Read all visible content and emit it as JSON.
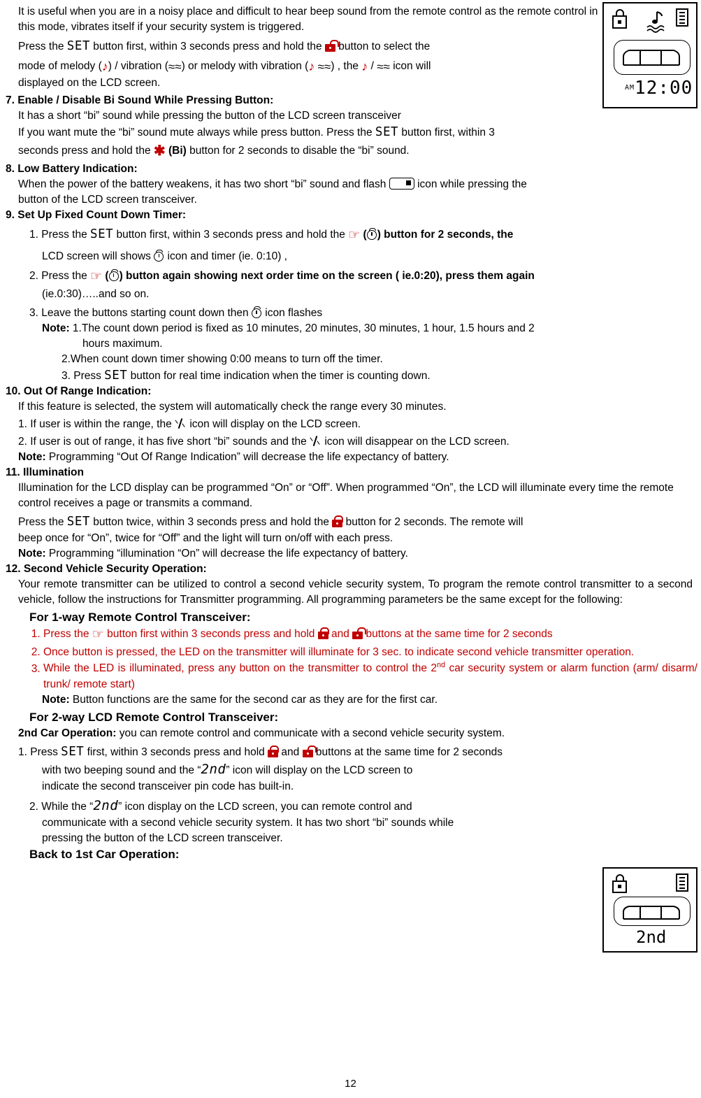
{
  "page_number": "12",
  "intro": {
    "line1": "It is useful when you are in a noisy place and difficult to hear beep sound from the remote control as the remote control in this mode, vibrates itself if your security system is triggered.",
    "line2_a": "Press the",
    "line2_set": "SET",
    "line2_b": "button first, within 3 seconds press and hold the",
    "line2_c": "button to select the",
    "line3_a": "mode of melody (",
    "line3_b": ") / vibration (",
    "line3_c": ") or melody with vibration (",
    "line3_d": ") , the",
    "line3_e": "/",
    "line3_f": "icon will",
    "line4": "displayed on the LCD screen."
  },
  "sections": [
    {
      "heading": "7. Enable / Disable Bi Sound While Pressing Button:",
      "lines": [
        "It has a short “bi” sound while pressing the button of the LCD screen transceiver",
        "If you want mute the “bi” sound mute always while press button. Press the",
        "button first, within 3",
        "seconds press and hold the",
        "(Bi)",
        "button for 2 seconds to disable the “bi” sound."
      ]
    },
    {
      "heading": "8. Low Battery Indication:",
      "lines": [
        "When the power of the battery weakens, it has two short “bi” sound and flash",
        "icon while pressing the",
        "button of the LCD screen transceiver."
      ]
    },
    {
      "heading": "9. Set Up Fixed Count Down Timer:",
      "item1_a": "1. Press the",
      "item1_set": "SET",
      "item1_b": "button first, within 3 seconds press and hold the",
      "item1_c": "(",
      "item1_d": ") button for 2 seconds, the",
      "item1_e": "LCD screen will shows",
      "item1_f": "icon and timer (ie. 0:10) ,",
      "item2_a": "2. Press the",
      "item2_b": "(",
      "item2_c": ") button again showing next order time on the screen ( ie.0:20), press them again",
      "item2_d": "(ie.0:30)…..and so on.",
      "item3_a": "3. Leave the buttons starting count down then",
      "item3_b": "icon flashes",
      "note_label": "Note:",
      "note1": "1.The count down period is fixed as 10 minutes, 20 minutes, 30 minutes, 1 hour, 1.5 hours and 2",
      "note1b": "hours maximum.",
      "note2": "2.When count down timer showing 0:00 means to turn off the timer.",
      "note3_a": "3. Press",
      "note3_set": "SET",
      "note3_b": "button for real time indication when the timer is counting down."
    },
    {
      "heading": "10. Out Of Range Indication:",
      "line1": "If this feature is selected, the system will automatically check the range every 30 minutes.",
      "line2_a": "1. If user is within the range, the",
      "line2_b": "icon will display on the LCD screen.",
      "line3_a": "2. If user is out of range, it has five short “bi” sounds and the",
      "line3_b": "icon will disappear on the LCD screen.",
      "note_label": "Note:",
      "note": "Programming “Out Of Range Indication” will decrease the life expectancy of battery."
    },
    {
      "heading": "11. Illumination",
      "line1": "Illumination for the LCD display can be programmed “On” or “Off”. When programmed “On”, the LCD will illuminate every time the remote control receives a page or transmits a command.",
      "line2_a": "Press the",
      "line2_set": "SET",
      "line2_b": "button twice, within 3 seconds press and hold the",
      "line2_c": "button for 2 seconds. The remote will",
      "line3": "beep once for “On”, twice for “Off” and the light will turn on/off with each press.",
      "note_label": "Note:",
      "note": "Programming “illumination “On” will decrease the life expectancy of battery."
    },
    {
      "heading": "12. Second Vehicle Security Operation:",
      "para": "Your remote transmitter can be utilized to control a second vehicle security system, To program the remote control transmitter to a second vehicle, follow the instructions for Transmitter programming. All programming parameters be the same except for the following:",
      "sub1_heading": "For 1-way Remote Control Transceiver:",
      "list": [
        {
          "a": "Press the",
          "b": "button first within 3 seconds press and hold",
          "c": "and",
          "d": "buttons at the same time for 2 seconds"
        },
        {
          "text": "Once button is pressed, the LED on the transmitter will illuminate for 3 sec. to indicate second vehicle transmitter operation."
        },
        {
          "text_a": "While the LED is illuminated, press any button on the transmitter to control the 2",
          "sup": "nd",
          "text_b": " car security system or alarm function (arm/ disarm/ trunk/ remote start)"
        }
      ],
      "note_label": "Note:",
      "note": "Button functions are the same for the second car as they are for the first car.",
      "sub2_heading": "For 2-way LCD Remote Control Transceiver:",
      "car2_label": "2nd Car Operation:",
      "car2_text": "you can remote control and communicate with a second vehicle security system.",
      "s1_a": "1. Press",
      "s1_set": "SET",
      "s1_b": "first, within 3 seconds press and hold",
      "s1_c": "and",
      "s1_d": "buttons at the same time for 2 seconds",
      "s1_e": "with two beeping sound and the “",
      "s1_seg": "2nd",
      "s1_f": "” icon will display on the LCD screen to",
      "s1_g": "indicate the second transceiver pin code has built-in.",
      "s2_a": "2. While the “",
      "s2_seg": "2nd",
      "s2_b": "” icon display on the LCD screen, you can remote control and",
      "s2_c": "communicate with a second vehicle security system. It has two short “bi” sounds while",
      "s2_d": "pressing the button of the LCD screen transceiver.",
      "back_heading": "Back to 1st Car Operation:"
    }
  ],
  "lcd_top": {
    "time_display": "12:00",
    "am_label": "AM"
  },
  "lcd_bottom": {
    "display": "2nd"
  },
  "colors": {
    "red_accent": "#c00000",
    "text": "#000000",
    "background": "#ffffff"
  }
}
